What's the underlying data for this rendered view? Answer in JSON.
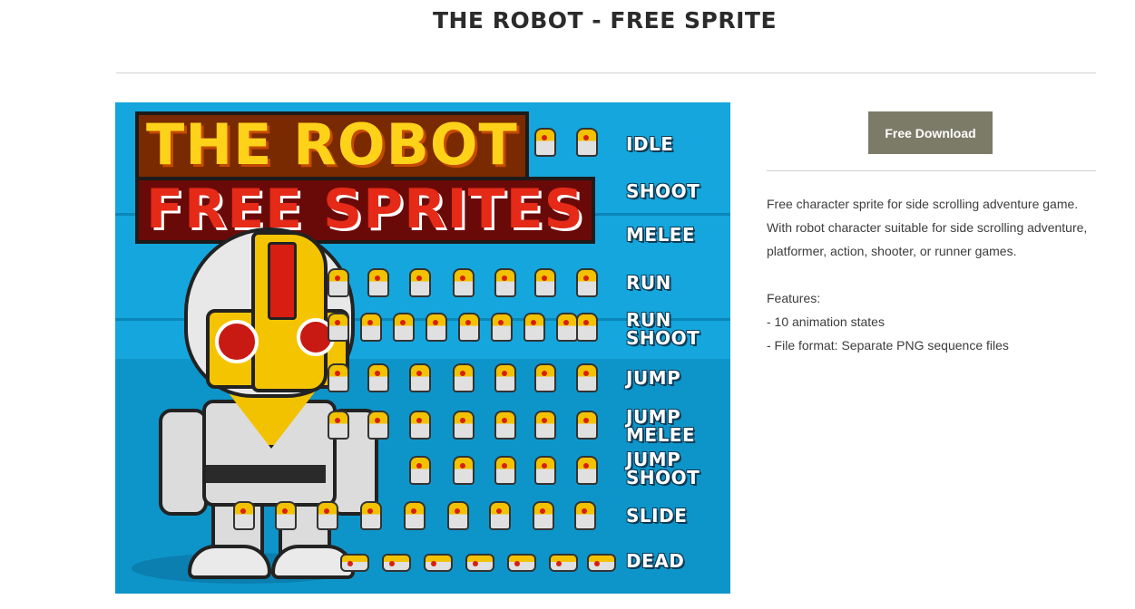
{
  "page": {
    "title": "THE ROBOT - FREE SPRITE"
  },
  "banner": {
    "logo_line1": "THE ROBOT",
    "logo_line2": "FREE SPRITES",
    "animation_labels": [
      "IDLE",
      "SHOOT",
      "MELEE",
      "RUN",
      "RUN\nSHOOT",
      "JUMP",
      "JUMP\nMELEE",
      "JUMP\nSHOOT",
      "SLIDE",
      "DEAD"
    ],
    "colors": {
      "background": "#14a6dc",
      "logo_yellow": "#ffd21a",
      "logo_red": "#e52a18"
    }
  },
  "download": {
    "label": "Free Download",
    "color": "#7c7b68"
  },
  "description": {
    "intro": "Free character sprite for side scrolling adventure game.",
    "line2": "With robot character suitable for side scrolling adventure,",
    "line3": "platformer, action, shooter, or runner games.",
    "features_heading": "Features:",
    "features": [
      "- 10 animation states",
      "- File format: Separate PNG sequence files"
    ]
  }
}
